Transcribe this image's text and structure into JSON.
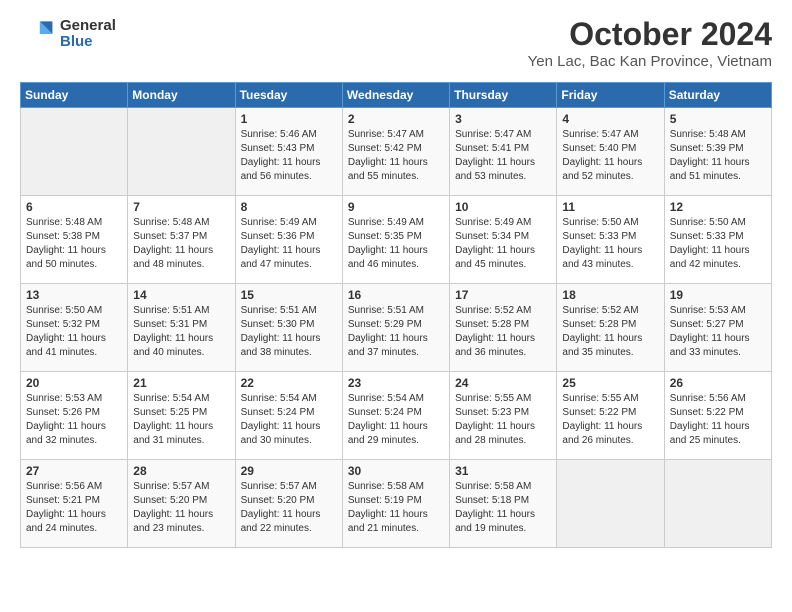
{
  "header": {
    "logo_general": "General",
    "logo_blue": "Blue",
    "month_title": "October 2024",
    "location": "Yen Lac, Bac Kan Province, Vietnam"
  },
  "weekdays": [
    "Sunday",
    "Monday",
    "Tuesday",
    "Wednesday",
    "Thursday",
    "Friday",
    "Saturday"
  ],
  "weeks": [
    [
      {
        "day": "",
        "text": ""
      },
      {
        "day": "",
        "text": ""
      },
      {
        "day": "1",
        "text": "Sunrise: 5:46 AM\nSunset: 5:43 PM\nDaylight: 11 hours and 56 minutes."
      },
      {
        "day": "2",
        "text": "Sunrise: 5:47 AM\nSunset: 5:42 PM\nDaylight: 11 hours and 55 minutes."
      },
      {
        "day": "3",
        "text": "Sunrise: 5:47 AM\nSunset: 5:41 PM\nDaylight: 11 hours and 53 minutes."
      },
      {
        "day": "4",
        "text": "Sunrise: 5:47 AM\nSunset: 5:40 PM\nDaylight: 11 hours and 52 minutes."
      },
      {
        "day": "5",
        "text": "Sunrise: 5:48 AM\nSunset: 5:39 PM\nDaylight: 11 hours and 51 minutes."
      }
    ],
    [
      {
        "day": "6",
        "text": "Sunrise: 5:48 AM\nSunset: 5:38 PM\nDaylight: 11 hours and 50 minutes."
      },
      {
        "day": "7",
        "text": "Sunrise: 5:48 AM\nSunset: 5:37 PM\nDaylight: 11 hours and 48 minutes."
      },
      {
        "day": "8",
        "text": "Sunrise: 5:49 AM\nSunset: 5:36 PM\nDaylight: 11 hours and 47 minutes."
      },
      {
        "day": "9",
        "text": "Sunrise: 5:49 AM\nSunset: 5:35 PM\nDaylight: 11 hours and 46 minutes."
      },
      {
        "day": "10",
        "text": "Sunrise: 5:49 AM\nSunset: 5:34 PM\nDaylight: 11 hours and 45 minutes."
      },
      {
        "day": "11",
        "text": "Sunrise: 5:50 AM\nSunset: 5:33 PM\nDaylight: 11 hours and 43 minutes."
      },
      {
        "day": "12",
        "text": "Sunrise: 5:50 AM\nSunset: 5:33 PM\nDaylight: 11 hours and 42 minutes."
      }
    ],
    [
      {
        "day": "13",
        "text": "Sunrise: 5:50 AM\nSunset: 5:32 PM\nDaylight: 11 hours and 41 minutes."
      },
      {
        "day": "14",
        "text": "Sunrise: 5:51 AM\nSunset: 5:31 PM\nDaylight: 11 hours and 40 minutes."
      },
      {
        "day": "15",
        "text": "Sunrise: 5:51 AM\nSunset: 5:30 PM\nDaylight: 11 hours and 38 minutes."
      },
      {
        "day": "16",
        "text": "Sunrise: 5:51 AM\nSunset: 5:29 PM\nDaylight: 11 hours and 37 minutes."
      },
      {
        "day": "17",
        "text": "Sunrise: 5:52 AM\nSunset: 5:28 PM\nDaylight: 11 hours and 36 minutes."
      },
      {
        "day": "18",
        "text": "Sunrise: 5:52 AM\nSunset: 5:28 PM\nDaylight: 11 hours and 35 minutes."
      },
      {
        "day": "19",
        "text": "Sunrise: 5:53 AM\nSunset: 5:27 PM\nDaylight: 11 hours and 33 minutes."
      }
    ],
    [
      {
        "day": "20",
        "text": "Sunrise: 5:53 AM\nSunset: 5:26 PM\nDaylight: 11 hours and 32 minutes."
      },
      {
        "day": "21",
        "text": "Sunrise: 5:54 AM\nSunset: 5:25 PM\nDaylight: 11 hours and 31 minutes."
      },
      {
        "day": "22",
        "text": "Sunrise: 5:54 AM\nSunset: 5:24 PM\nDaylight: 11 hours and 30 minutes."
      },
      {
        "day": "23",
        "text": "Sunrise: 5:54 AM\nSunset: 5:24 PM\nDaylight: 11 hours and 29 minutes."
      },
      {
        "day": "24",
        "text": "Sunrise: 5:55 AM\nSunset: 5:23 PM\nDaylight: 11 hours and 28 minutes."
      },
      {
        "day": "25",
        "text": "Sunrise: 5:55 AM\nSunset: 5:22 PM\nDaylight: 11 hours and 26 minutes."
      },
      {
        "day": "26",
        "text": "Sunrise: 5:56 AM\nSunset: 5:22 PM\nDaylight: 11 hours and 25 minutes."
      }
    ],
    [
      {
        "day": "27",
        "text": "Sunrise: 5:56 AM\nSunset: 5:21 PM\nDaylight: 11 hours and 24 minutes."
      },
      {
        "day": "28",
        "text": "Sunrise: 5:57 AM\nSunset: 5:20 PM\nDaylight: 11 hours and 23 minutes."
      },
      {
        "day": "29",
        "text": "Sunrise: 5:57 AM\nSunset: 5:20 PM\nDaylight: 11 hours and 22 minutes."
      },
      {
        "day": "30",
        "text": "Sunrise: 5:58 AM\nSunset: 5:19 PM\nDaylight: 11 hours and 21 minutes."
      },
      {
        "day": "31",
        "text": "Sunrise: 5:58 AM\nSunset: 5:18 PM\nDaylight: 11 hours and 19 minutes."
      },
      {
        "day": "",
        "text": ""
      },
      {
        "day": "",
        "text": ""
      }
    ]
  ]
}
